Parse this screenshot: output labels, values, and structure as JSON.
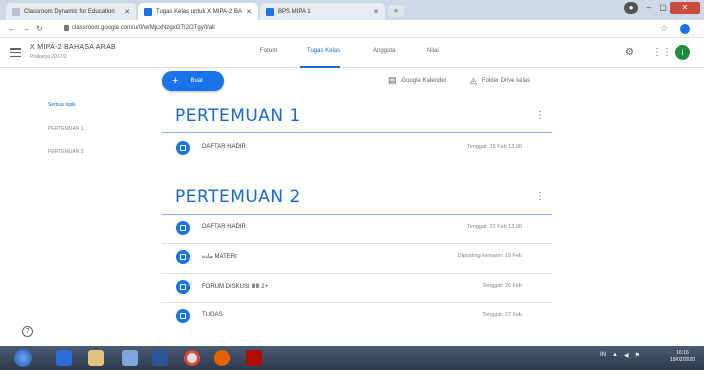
{
  "browser": {
    "tabs": [
      {
        "label": "Classroom Dynamic for Education"
      },
      {
        "label": "Tugas Kelas untuk X MIPA-2 BA"
      },
      {
        "label": "BPS MIPA 1"
      }
    ],
    "url": "classroom.google.com/u/0/w/MjcxNzgxOTI2OTgy/t/all"
  },
  "classroom": {
    "class_title": "X MIPA-2 BAHASA ARAB",
    "class_subtitle": "Prakarya 2017/2",
    "nav": {
      "forum": "Forum",
      "tugas": "Tugas Kelas",
      "anggota": "Anggota",
      "nilai": "Nilai"
    },
    "avatar_letter": "i",
    "create_label": "Buat",
    "create_plus": "+",
    "calendar_label": "Google Kalender",
    "drive_label": "Folder Drive kelas",
    "sidebar": [
      "Semua topik",
      "PERTEMUAN 1",
      "PERTEMUAN 2"
    ],
    "topics": [
      {
        "title": "PERTEMUAN 1",
        "items": [
          {
            "title": "DAFTAR HADIR",
            "due": "Tenggat: 15 Feb 13.00"
          }
        ]
      },
      {
        "title": "PERTEMUAN 2",
        "items": [
          {
            "title": "DAFTAR HADIR",
            "due": "Tenggat: 22 Feb 13.00"
          },
          {
            "title": "مادة MATERI",
            "due": "Diposting kemarin: 19 Feb"
          },
          {
            "title": "FORUM DISKUSI ⅢⅢ 2+",
            "due": "Tenggat: 26 Feb"
          },
          {
            "title": "TUGAS",
            "due": "Tenggat: 27 Feb"
          }
        ]
      }
    ],
    "topic_menu_glyph": "⋮"
  },
  "taskbar": {
    "clock_time": "16:16",
    "clock_date": "19/02/2020",
    "tray_lang": "IN"
  }
}
